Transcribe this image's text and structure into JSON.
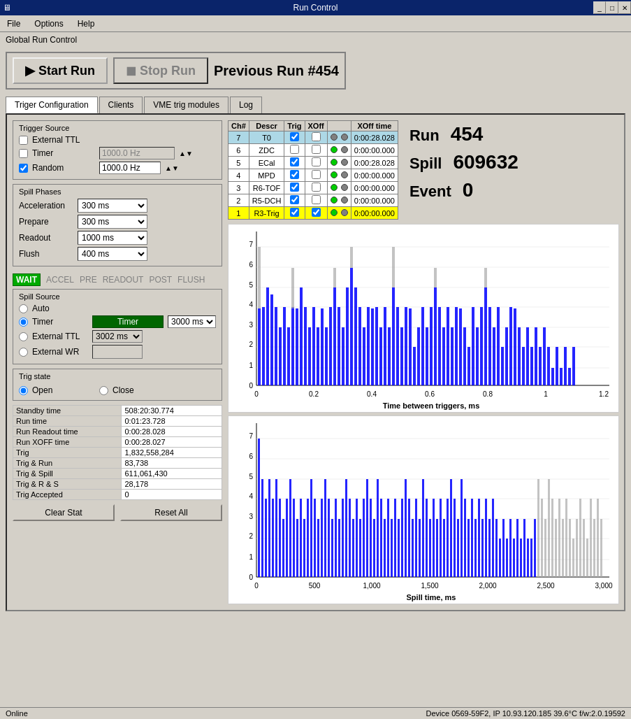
{
  "window": {
    "title": "Run Control",
    "icon": "⊞"
  },
  "menu": {
    "items": [
      "File",
      "Options",
      "Help"
    ]
  },
  "global_label": "Global Run Control",
  "buttons": {
    "start": "▶ Start Run",
    "stop": "◼ Stop Run",
    "prev_run": "Previous Run #454"
  },
  "tabs": [
    "Triger Configuration",
    "Clients",
    "VME trig modules",
    "Log"
  ],
  "active_tab": 0,
  "trigger_source": {
    "title": "Trigger Source",
    "external_ttl": {
      "label": "External TTL",
      "checked": false
    },
    "timer": {
      "label": "Timer",
      "checked": false,
      "value": "1000.0 Hz"
    },
    "random": {
      "label": "Random",
      "checked": true,
      "value": "1000.0 Hz"
    }
  },
  "spill_phases": {
    "title": "Spill Phases",
    "phases": [
      {
        "label": "Acceleration",
        "value": "300 ms"
      },
      {
        "label": "Prepare",
        "value": "300 ms"
      },
      {
        "label": "Readout",
        "value": "1000 ms"
      },
      {
        "label": "Flush",
        "value": "400 ms"
      }
    ]
  },
  "state_labels": [
    "WAIT",
    "ACCEL",
    "PRE",
    "READOUT",
    "POST",
    "FLUSH"
  ],
  "active_state": "WAIT",
  "spill_source": {
    "title": "Spill Source",
    "options": [
      "Auto",
      "Timer",
      "External TTL",
      "External WR"
    ],
    "selected": "Timer",
    "timer_badge": "Timer",
    "timer_value": "3000 ms",
    "ext_ttl_value": "3002 ms",
    "ext_wr_value": ""
  },
  "trig_state": {
    "title": "Trig state",
    "options": [
      "Open",
      "Close"
    ],
    "selected": "Open"
  },
  "stats": {
    "rows": [
      {
        "label": "Standby time",
        "value": "508:20:30.774"
      },
      {
        "label": "Run time",
        "value": "0:01:23.728"
      },
      {
        "label": "Run Readout time",
        "value": "0:00:28.028"
      },
      {
        "label": "Run XOFF time",
        "value": "0:00:28.027"
      },
      {
        "label": "Trig",
        "value": "1,832,558,284"
      },
      {
        "label": "Trig & Run",
        "value": "83,738"
      },
      {
        "label": "Trig & Spill",
        "value": "611,061,430"
      },
      {
        "label": "Trig & R & S",
        "value": "28,178"
      },
      {
        "label": "Trig Accepted",
        "value": "0"
      }
    ]
  },
  "action_buttons": {
    "clear_stat": "Clear Stat",
    "reset_all": "Reset All"
  },
  "trig_table": {
    "headers": [
      "Ch#",
      "Descr",
      "Trig",
      "XOff",
      "",
      "XOff time"
    ],
    "rows": [
      {
        "ch": "7",
        "descr": "T0",
        "trig": true,
        "xoff": false,
        "led1": "gray",
        "led2": "gray",
        "xoff_time": "0:00:28.028",
        "selected": true,
        "color": "blue"
      },
      {
        "ch": "6",
        "descr": "ZDC",
        "trig": false,
        "xoff": false,
        "led1": "green",
        "led2": "gray",
        "xoff_time": "0:00:00.000",
        "color": "white"
      },
      {
        "ch": "5",
        "descr": "ECal",
        "trig": true,
        "xoff": false,
        "led1": "green",
        "led2": "gray",
        "xoff_time": "0:00:28.028",
        "color": "white"
      },
      {
        "ch": "4",
        "descr": "MPD",
        "trig": true,
        "xoff": false,
        "led1": "green",
        "led2": "gray",
        "xoff_time": "0:00:00.000",
        "color": "white"
      },
      {
        "ch": "3",
        "descr": "R6-TOF",
        "trig": true,
        "xoff": false,
        "led1": "green",
        "led2": "gray",
        "xoff_time": "0:00:00.000",
        "color": "white"
      },
      {
        "ch": "2",
        "descr": "R5-DCH",
        "trig": true,
        "xoff": false,
        "led1": "green",
        "led2": "gray",
        "xoff_time": "0:00:00.000",
        "color": "white"
      },
      {
        "ch": "1",
        "descr": "R3-Trig",
        "trig": true,
        "xoff": true,
        "led1": "green",
        "led2": "gray",
        "xoff_time": "0:00:00.000",
        "color": "yellow"
      }
    ]
  },
  "run_info": {
    "run_label": "Run",
    "run_value": "454",
    "spill_label": "Spill",
    "spill_value": "609632",
    "event_label": "Event",
    "event_value": "0"
  },
  "chart1": {
    "title": "Time between triggers, ms",
    "x_label": "Time between triggers, ms",
    "x_range": [
      0,
      1.2
    ],
    "y_range": [
      0,
      8
    ]
  },
  "chart2": {
    "title": "Spill time, ms",
    "x_label": "Spill time, ms",
    "x_range": [
      0,
      3000
    ],
    "y_range": [
      0,
      7
    ]
  },
  "status_bar": {
    "left": "Online",
    "right": "Device 0569-59F2, IP 10.93.120.185  39.6°C f/w:2.0.19592"
  }
}
